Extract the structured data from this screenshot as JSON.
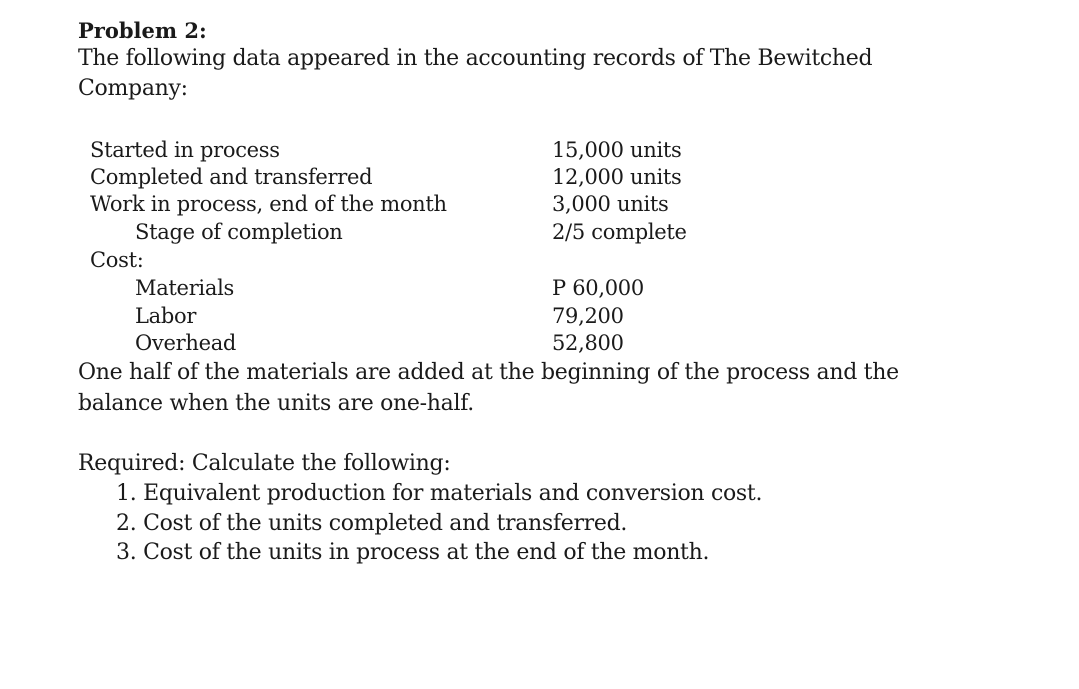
{
  "problem": {
    "title": "Problem 2:",
    "intro_line1": "The following data appeared in the accounting records of The Bewitched",
    "intro_line2": "Company:",
    "data_rows": [
      {
        "label": "Started in process",
        "value": "15,000 units"
      },
      {
        "label": "Completed and transferred",
        "value": "12,000 units"
      },
      {
        "label": "Work in process, end of the month",
        "value": "3,000 units"
      },
      {
        "label": "Stage of completion",
        "value": "2/5 complete"
      }
    ],
    "cost_heading": "Cost:",
    "cost_rows": [
      {
        "label": "Materials",
        "value": "P 60,000"
      },
      {
        "label": "Labor",
        "value": "79,200"
      },
      {
        "label": "Overhead",
        "value": "52,800"
      }
    ],
    "note_line1": "One half of the materials are added at the beginning of the process and the",
    "note_line2": "balance when the units are one-half.",
    "required_heading": "Required: Calculate the following:",
    "required_items": [
      "1.  Equivalent production for materials and conversion cost.",
      "2.  Cost of the units completed and transferred.",
      "3.  Cost of the units in process at the end of the month."
    ]
  }
}
